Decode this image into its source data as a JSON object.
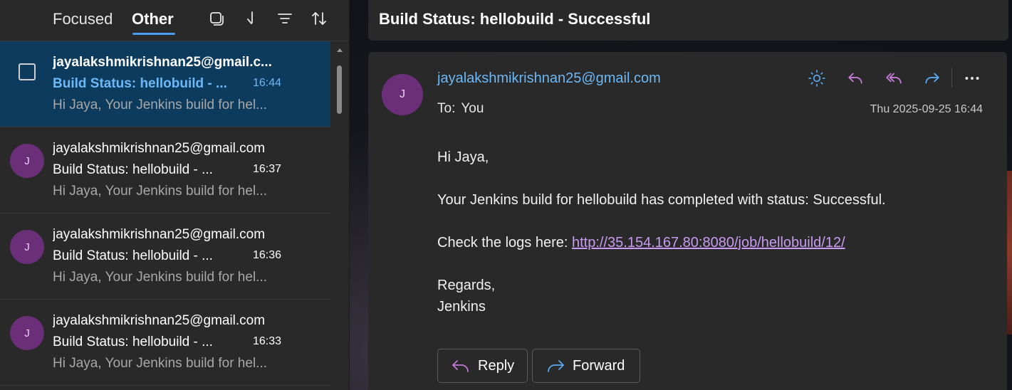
{
  "header": {
    "tabs": [
      {
        "label": "Focused"
      },
      {
        "label": "Other"
      }
    ],
    "icons": [
      "select-mode-icon",
      "jump-to-icon",
      "filter-icon",
      "sort-icon"
    ]
  },
  "messages": [
    {
      "sender": "jayalakshmikrishnan25@gmail.c...",
      "subject": "Build Status: hellobuild - ...",
      "time": "16:44",
      "preview": "Hi Jaya, Your Jenkins build for hel...",
      "avatar": "J"
    },
    {
      "sender": "jayalakshmikrishnan25@gmail.com",
      "subject": "Build Status: hellobuild - ...",
      "time": "16:37",
      "preview": "Hi Jaya, Your Jenkins build for hel...",
      "avatar": "J"
    },
    {
      "sender": "jayalakshmikrishnan25@gmail.com",
      "subject": "Build Status: hellobuild - ...",
      "time": "16:36",
      "preview": "Hi Jaya, Your Jenkins build for hel...",
      "avatar": "J"
    },
    {
      "sender": "jayalakshmikrishnan25@gmail.com",
      "subject": "Build Status: hellobuild - ...",
      "time": "16:33",
      "preview": "Hi Jaya, Your Jenkins build for hel...",
      "avatar": "J"
    }
  ],
  "reading": {
    "subject": "Build Status: hellobuild - Successful",
    "avatar": "J",
    "from": "jayalakshmikrishnan25@gmail.com",
    "to_label": "To:",
    "to_value": "You",
    "date": "Thu 2025-09-25 16:44",
    "body": {
      "greeting": "Hi Jaya,",
      "line1": "Your Jenkins build for hellobuild has completed with status: Successful.",
      "logs_prefix": "Check the logs here: ",
      "logs_link": "http://35.154.167.80:8080/job/hellobuild/12/",
      "regards": "Regards,",
      "signature": "Jenkins"
    },
    "reply_label": "Reply",
    "forward_label": "Forward"
  },
  "colors": {
    "accent": "#479ef5",
    "selected_row": "#0c3b5e",
    "avatar_bg": "#6b2f7a",
    "link": "#c89bf0",
    "reply_icon": "#c47ad6",
    "forward_icon": "#5aa8f0"
  }
}
